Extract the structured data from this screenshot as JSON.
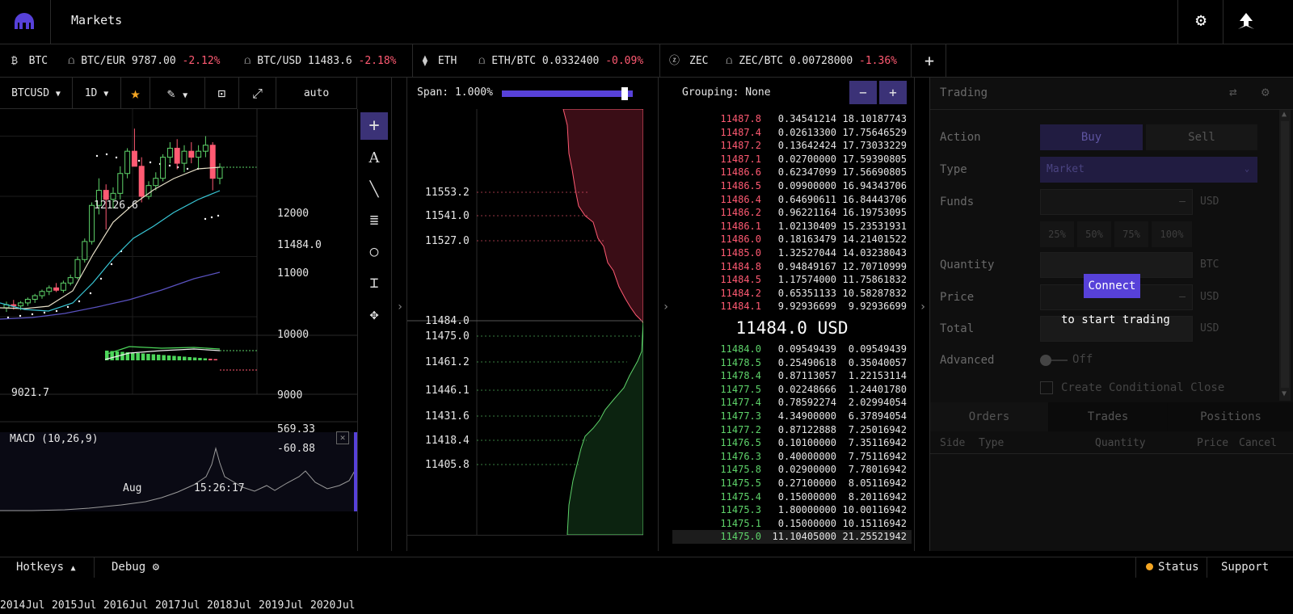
{
  "header": {
    "title": "Markets"
  },
  "ticker": {
    "groups": [
      {
        "name": "BTC",
        "pairs": [
          {
            "pair": "BTC/EUR",
            "price": "9787.00",
            "change": "-2.12%"
          },
          {
            "pair": "BTC/USD",
            "price": "11483.6",
            "change": "-2.18%"
          }
        ]
      },
      {
        "name": "ETH",
        "pairs": [
          {
            "pair": "ETH/BTC",
            "price": "0.0332400",
            "change": "-0.09%"
          }
        ]
      },
      {
        "name": "ZEC",
        "pairs": [
          {
            "pair": "ZEC/BTC",
            "price": "0.00728000",
            "change": "-1.36%"
          }
        ]
      }
    ],
    "add_label": "+"
  },
  "chart": {
    "symbol": "BTCUSD",
    "interval": "1D",
    "scale": "auto",
    "price_ticks": [
      "12000",
      "11000",
      "10000",
      "9000"
    ],
    "current_price": "11484.0",
    "high_label": "12126.6",
    "low_label": "9021.7",
    "macd_label": "MACD (10,26,9)",
    "macd_value1": "569.33",
    "macd_value2": "-60.88",
    "x_label": "Aug",
    "time_label": "15:26:17",
    "nav_years": [
      "2014",
      "Jul",
      "2015",
      "Jul",
      "2016",
      "Jul",
      "2017",
      "Jul",
      "2018",
      "Jul",
      "2019",
      "Jul",
      "2020",
      "Jul"
    ],
    "candles": [
      {
        "o": 9150,
        "h": 9250,
        "l": 9080,
        "c": 9200
      },
      {
        "o": 9200,
        "h": 9280,
        "l": 9120,
        "c": 9180
      },
      {
        "o": 9180,
        "h": 9260,
        "l": 9110,
        "c": 9230
      },
      {
        "o": 9230,
        "h": 9320,
        "l": 9180,
        "c": 9290
      },
      {
        "o": 9290,
        "h": 9380,
        "l": 9230,
        "c": 9350
      },
      {
        "o": 9350,
        "h": 9450,
        "l": 9300,
        "c": 9420
      },
      {
        "o": 9420,
        "h": 9520,
        "l": 9360,
        "c": 9480
      },
      {
        "o": 9480,
        "h": 9560,
        "l": 9410,
        "c": 9440
      },
      {
        "o": 9440,
        "h": 9600,
        "l": 9400,
        "c": 9560
      },
      {
        "o": 9560,
        "h": 9700,
        "l": 9520,
        "c": 9650
      },
      {
        "o": 9650,
        "h": 10000,
        "l": 9620,
        "c": 9950
      },
      {
        "o": 9950,
        "h": 10300,
        "l": 9900,
        "c": 10250
      },
      {
        "o": 10250,
        "h": 10900,
        "l": 10200,
        "c": 10850
      },
      {
        "o": 10850,
        "h": 11300,
        "l": 10700,
        "c": 11100
      },
      {
        "o": 11100,
        "h": 11200,
        "l": 10450,
        "c": 10950
      },
      {
        "o": 10950,
        "h": 11150,
        "l": 10800,
        "c": 11050
      },
      {
        "o": 11050,
        "h": 11500,
        "l": 10950,
        "c": 11380
      },
      {
        "o": 11380,
        "h": 11800,
        "l": 11300,
        "c": 11750
      },
      {
        "o": 11750,
        "h": 12126,
        "l": 11600,
        "c": 11500
      },
      {
        "o": 11500,
        "h": 11650,
        "l": 10900,
        "c": 11000
      },
      {
        "o": 11000,
        "h": 11250,
        "l": 10950,
        "c": 11180
      },
      {
        "o": 11180,
        "h": 11400,
        "l": 11100,
        "c": 11300
      },
      {
        "o": 11300,
        "h": 11700,
        "l": 11250,
        "c": 11650
      },
      {
        "o": 11650,
        "h": 11900,
        "l": 11550,
        "c": 11800
      },
      {
        "o": 11800,
        "h": 11950,
        "l": 11450,
        "c": 11550
      },
      {
        "o": 11550,
        "h": 11850,
        "l": 11400,
        "c": 11750
      },
      {
        "o": 11750,
        "h": 11900,
        "l": 11550,
        "c": 11650
      },
      {
        "o": 11650,
        "h": 11850,
        "l": 11450,
        "c": 11750
      },
      {
        "o": 11750,
        "h": 12000,
        "l": 11650,
        "c": 11850
      },
      {
        "o": 11850,
        "h": 11900,
        "l": 11100,
        "c": 11300
      },
      {
        "o": 11300,
        "h": 11550,
        "l": 11200,
        "c": 11484
      }
    ]
  },
  "depth": {
    "span_label": "Span: 1.000%",
    "ask_levels": [
      "11553.2",
      "11541.0",
      "11527.0"
    ],
    "mid_price": "11484.0",
    "bid_levels": [
      "11475.0",
      "11461.2",
      "11446.1",
      "11431.6",
      "11418.4",
      "11405.8"
    ]
  },
  "book": {
    "grouping_label": "Grouping: None",
    "minus_label": "−",
    "plus_label": "+",
    "asks": [
      [
        "11487.8",
        "0.34541214",
        "18.10187743"
      ],
      [
        "11487.4",
        "0.02613300",
        "17.75646529"
      ],
      [
        "11487.2",
        "0.13642424",
        "17.73033229"
      ],
      [
        "11487.1",
        "0.02700000",
        "17.59390805"
      ],
      [
        "11486.6",
        "0.62347099",
        "17.56690805"
      ],
      [
        "11486.5",
        "0.09900000",
        "16.94343706"
      ],
      [
        "11486.4",
        "0.64690611",
        "16.84443706"
      ],
      [
        "11486.2",
        "0.96221164",
        "16.19753095"
      ],
      [
        "11486.1",
        "1.02130409",
        "15.23531931"
      ],
      [
        "11486.0",
        "0.18163479",
        "14.21401522"
      ],
      [
        "11485.0",
        "1.32527044",
        "14.03238043"
      ],
      [
        "11484.8",
        "0.94849167",
        "12.70710999"
      ],
      [
        "11484.5",
        "1.17574000",
        "11.75861832"
      ],
      [
        "11484.2",
        "0.65351133",
        "10.58287832"
      ],
      [
        "11484.1",
        "9.92936699",
        "9.92936699"
      ]
    ],
    "mid_price": "11484.0 USD",
    "bids": [
      [
        "11484.0",
        "0.09549439",
        "0.09549439"
      ],
      [
        "11478.5",
        "0.25490618",
        "0.35040057"
      ],
      [
        "11478.4",
        "0.87113057",
        "1.22153114"
      ],
      [
        "11477.5",
        "0.02248666",
        "1.24401780"
      ],
      [
        "11477.4",
        "0.78592274",
        "2.02994054"
      ],
      [
        "11477.3",
        "4.34900000",
        "6.37894054"
      ],
      [
        "11477.2",
        "0.87122888",
        "7.25016942"
      ],
      [
        "11476.5",
        "0.10100000",
        "7.35116942"
      ],
      [
        "11476.3",
        "0.40000000",
        "7.75116942"
      ],
      [
        "11475.8",
        "0.02900000",
        "7.78016942"
      ],
      [
        "11475.5",
        "0.27100000",
        "8.05116942"
      ],
      [
        "11475.4",
        "0.15000000",
        "8.20116942"
      ],
      [
        "11475.3",
        "1.80000000",
        "10.00116942"
      ],
      [
        "11475.1",
        "0.15000000",
        "10.15116942"
      ],
      [
        "11475.0",
        "11.10405000",
        "21.25521942"
      ]
    ]
  },
  "trading": {
    "title": "Trading",
    "action_label": "Action",
    "buy_label": "Buy",
    "sell_label": "Sell",
    "type_label": "Type",
    "type_value": "Market",
    "funds_label": "Funds",
    "funds_unit": "USD",
    "dash": "–",
    "pcts": [
      "25%",
      "50%",
      "75%",
      "100%"
    ],
    "quantity_label": "Quantity",
    "quantity_unit": "BTC",
    "price_label": "Price",
    "price_unit": "USD",
    "total_label": "Total",
    "total_unit": "USD",
    "connect_label": "Connect",
    "connect_note": "to start trading",
    "advanced_label": "Advanced",
    "advanced_state": "Off",
    "conditional_label": "Create Conditional Close",
    "tabs": [
      "Orders",
      "Trades",
      "Positions"
    ],
    "columns": [
      "Side",
      "Type",
      "Quantity",
      "Price",
      "Cancel"
    ]
  },
  "statusbar": {
    "hotkeys": "Hotkeys",
    "debug": "Debug",
    "status": "Status",
    "support": "Support"
  },
  "colors": {
    "accent": "#5741d9",
    "ask": "#ff5a72",
    "bid": "#5ed36a"
  }
}
